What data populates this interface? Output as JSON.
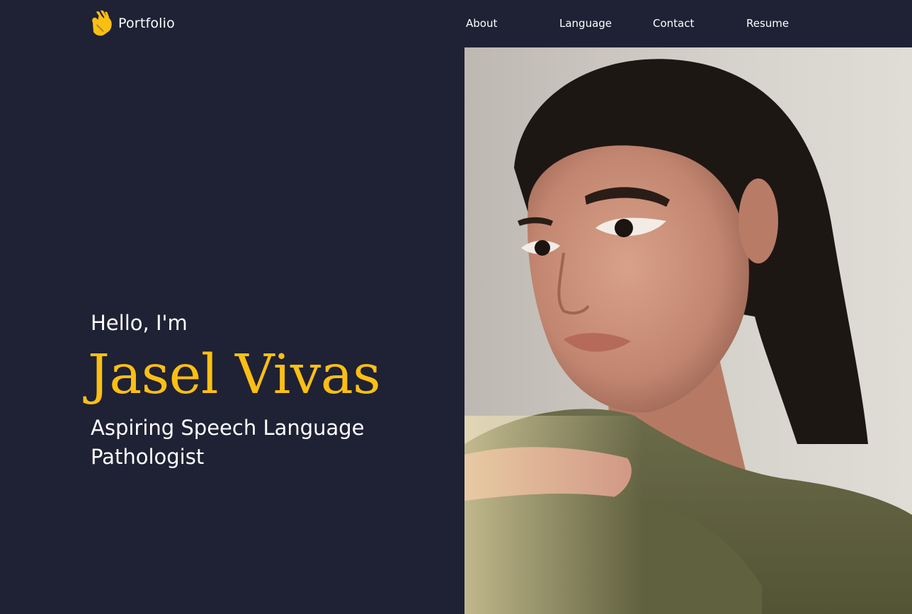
{
  "brand": {
    "name": "Portfolio",
    "icon": "sign-language-hands-icon"
  },
  "nav": {
    "items": [
      {
        "label": "About"
      },
      {
        "label": "Language"
      },
      {
        "label": "Contact"
      },
      {
        "label": "Resume"
      }
    ]
  },
  "hero": {
    "greeting": "Hello, I'm",
    "name": "Jasel Vivas",
    "role": "Aspiring Speech Language Pathologist"
  },
  "colors": {
    "background": "#1f2135",
    "accent": "#fbbf14",
    "text": "#ffffff"
  }
}
